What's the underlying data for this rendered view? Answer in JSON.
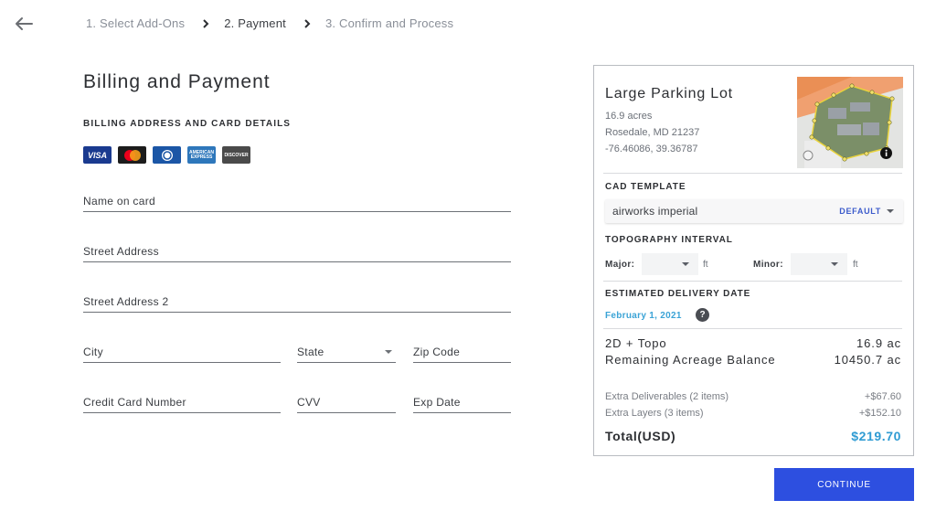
{
  "stepper": {
    "steps": [
      {
        "label": "1. Select Add-Ons"
      },
      {
        "label": "2. Payment"
      },
      {
        "label": "3. Confirm and Process"
      }
    ]
  },
  "billing": {
    "title": "Billing and Payment",
    "section_label": "BILLING ADDRESS AND CARD DETAILS",
    "cards": {
      "visa": "VISA",
      "amex": "AMERICAN EXPRESS",
      "discover": "DISCOVER"
    },
    "fields": {
      "name_on_card": "Name on card",
      "street_address": "Street Address",
      "street_address_2": "Street Address 2",
      "city": "City",
      "state": "State",
      "zip": "Zip Code",
      "card_number": "Credit Card Number",
      "cvv": "CVV",
      "exp_date": "Exp Date"
    }
  },
  "summary": {
    "title": "Large Parking Lot",
    "acres": "16.9 acres",
    "location": "Rosedale, MD 21237",
    "coords": "-76.46086, 39.36787",
    "cad_label": "CAD TEMPLATE",
    "cad_value": "airworks imperial",
    "cad_badge": "DEFAULT",
    "topo_label": "TOPOGRAPHY INTERVAL",
    "major_label": "Major:",
    "minor_label": "Minor:",
    "unit": "ft",
    "delivery_label": "ESTIMATED DELIVERY DATE",
    "delivery_date": "February 1, 2021",
    "help": "?",
    "rows": [
      {
        "label": "2D + Topo",
        "value": "16.9 ac"
      },
      {
        "label": "Remaining Acreage Balance",
        "value": "10450.7 ac"
      }
    ],
    "extras": [
      {
        "label": "Extra Deliverables (2 items)",
        "value": "+$67.60"
      },
      {
        "label": "Extra Layers (3 items)",
        "value": "+$152.10"
      }
    ],
    "total_label": "Total(USD)",
    "total_value": "$219.70"
  },
  "continue_label": "CONTINUE",
  "colors": {
    "accent": "#2d4fe0",
    "total": "#2f9bd3",
    "date": "#3aa3d6"
  }
}
